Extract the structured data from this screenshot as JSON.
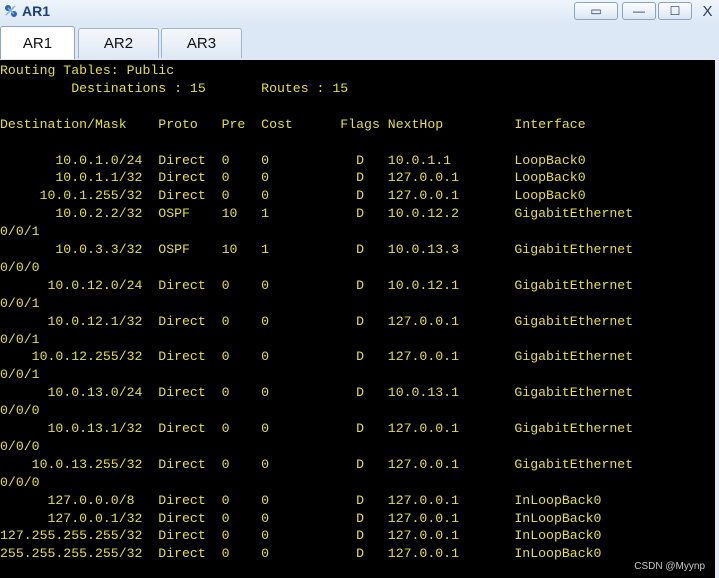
{
  "window": {
    "title": "AR1",
    "restore_label": "▭",
    "minimize_label": "—",
    "maximize_label": "☐",
    "close_label": "X"
  },
  "tabs": [
    {
      "label": "AR1",
      "active": true
    },
    {
      "label": "AR2",
      "active": false
    },
    {
      "label": "AR3",
      "active": false
    }
  ],
  "terminal": {
    "lines": [
      "Routing Tables: Public",
      "         Destinations : 15       Routes : 15",
      "",
      "Destination/Mask    Proto   Pre  Cost      Flags NextHop         Interface",
      "",
      "       10.0.1.0/24  Direct  0    0           D   10.0.1.1        LoopBack0",
      "       10.0.1.1/32  Direct  0    0           D   127.0.0.1       LoopBack0",
      "     10.0.1.255/32  Direct  0    0           D   127.0.0.1       LoopBack0",
      "       10.0.2.2/32  OSPF    10   1           D   10.0.12.2       GigabitEthernet",
      "0/0/1",
      "       10.0.3.3/32  OSPF    10   1           D   10.0.13.3       GigabitEthernet",
      "0/0/0",
      "      10.0.12.0/24  Direct  0    0           D   10.0.12.1       GigabitEthernet",
      "0/0/1",
      "      10.0.12.1/32  Direct  0    0           D   127.0.0.1       GigabitEthernet",
      "0/0/1",
      "    10.0.12.255/32  Direct  0    0           D   127.0.0.1       GigabitEthernet",
      "0/0/1",
      "      10.0.13.0/24  Direct  0    0           D   10.0.13.1       GigabitEthernet",
      "0/0/0",
      "      10.0.13.1/32  Direct  0    0           D   127.0.0.1       GigabitEthernet",
      "0/0/0",
      "    10.0.13.255/32  Direct  0    0           D   127.0.0.1       GigabitEthernet",
      "0/0/0",
      "      127.0.0.0/8   Direct  0    0           D   127.0.0.1       InLoopBack0",
      "      127.0.0.1/32  Direct  0    0           D   127.0.0.1       InLoopBack0",
      "127.255.255.255/32  Direct  0    0           D   127.0.0.1       InLoopBack0",
      "255.255.255.255/32  Direct  0    0           D   127.0.0.1       InLoopBack0"
    ]
  },
  "watermark": "CSDN @Myynp",
  "colors": {
    "terminal_bg": "#000000",
    "terminal_fg": "#e8df3a"
  }
}
